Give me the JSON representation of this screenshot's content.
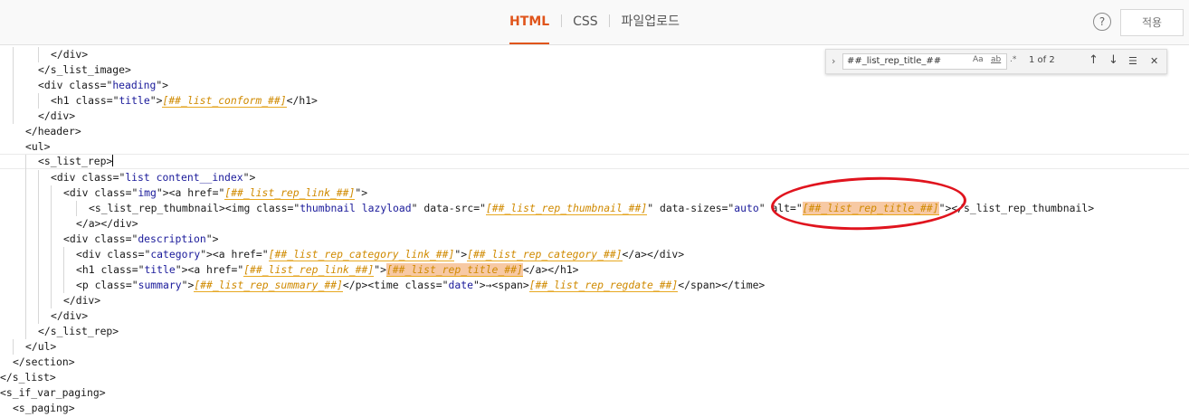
{
  "toolbar": {
    "tabs": [
      {
        "label": "HTML",
        "active": true
      },
      {
        "label": "CSS",
        "active": false
      },
      {
        "label": "파일업로드",
        "active": false
      }
    ],
    "help_label": "?",
    "apply_label": "적용"
  },
  "find": {
    "query": "##_list_rep_title_##",
    "opt_case": "Aa",
    "opt_word": "ab",
    "opt_regex": ".*",
    "count": "1 of 2",
    "prev_icon": "↑",
    "next_icon": "↓",
    "selection_icon": "☰",
    "close_icon": "✕",
    "toggle_icon": "›"
  },
  "code": {
    "l1": "</div>",
    "l2": "</s_list_image>",
    "l3_a": "<div ",
    "l3_b": "class",
    "l3_c": "=\"",
    "l3_d": "heading",
    "l3_e": "\">",
    "l4_a": "<h1 ",
    "l4_b": "class",
    "l4_c": "=\"",
    "l4_d": "title",
    "l4_e": "\">",
    "l4_f": "[##_list_conform_##]",
    "l4_g": "</h1>",
    "l5": "</div>",
    "l6": "</header>",
    "l7": "<ul>",
    "l8": "<s_list_rep>",
    "l9_a": "<div ",
    "l9_b": "class",
    "l9_c": "=\"",
    "l9_d": "list content__index",
    "l9_e": "\">",
    "l10_a": "<div ",
    "l10_b": "class",
    "l10_c": "=\"",
    "l10_d": "img",
    "l10_e": "\"><a ",
    "l10_f": "href",
    "l10_g": "=\"",
    "l10_h": "[##_list_rep_link_##]",
    "l10_i": "\">",
    "l11_a": "<s_list_rep_thumbnail><img ",
    "l11_b": "class",
    "l11_c": "=\"",
    "l11_d": "thumbnail lazyload",
    "l11_e": "\" ",
    "l11_f": "data-src",
    "l11_g": "=\"",
    "l11_h": "[##_list_rep_thumbnail_##]",
    "l11_i": "\" ",
    "l11_j": "data-sizes",
    "l11_k": "=\"",
    "l11_l": "auto",
    "l11_m": "\" ",
    "l11_n": "alt",
    "l11_o": "=\"",
    "l11_p": "[##_list_rep_title_##]",
    "l11_q": "\"></s_list_rep_thumbnail>",
    "l12": "</a></div>",
    "l13_a": "<div ",
    "l13_b": "class",
    "l13_c": "=\"",
    "l13_d": "description",
    "l13_e": "\">",
    "l14_a": "<div ",
    "l14_b": "class",
    "l14_c": "=\"",
    "l14_d": "category",
    "l14_e": "\"><a ",
    "l14_f": "href",
    "l14_g": "=\"",
    "l14_h": "[##_list_rep_category_link_##]",
    "l14_i": "\">",
    "l14_j": "[##_list_rep_category_##]",
    "l14_k": "</a></div>",
    "l15_a": "<h1 ",
    "l15_b": "class",
    "l15_c": "=\"",
    "l15_d": "title",
    "l15_e": "\"><a ",
    "l15_f": "href",
    "l15_g": "=\"",
    "l15_h": "[##_list_rep_link_##]",
    "l15_i": "\">",
    "l15_j": "[##_list_rep_title_##]",
    "l15_k": "</a></h1>",
    "l16_a": "<p ",
    "l16_b": "class",
    "l16_c": "=\"",
    "l16_d": "summary",
    "l16_e": "\">",
    "l16_f": "[##_list_rep_summary_##]",
    "l16_g": "</p><time ",
    "l16_h": "class",
    "l16_i": "=\"",
    "l16_j": "date",
    "l16_k": "\">→<span>",
    "l16_l": "[##_list_rep_regdate_##]",
    "l16_m": "</span></time>",
    "l17": "</div>",
    "l18": "</div>",
    "l19": "</s_list_rep>",
    "l20": "</ul>",
    "l21": "</section>",
    "l22": "</s_list>",
    "l23": "<s_if_var_paging>",
    "l24": "<s_paging>"
  },
  "colors": {
    "accent": "#e0551c",
    "annotation": "#e0141e",
    "variable": "#d08a00",
    "attr_value": "#1a1a9a",
    "highlight": "#f7c9a4"
  }
}
